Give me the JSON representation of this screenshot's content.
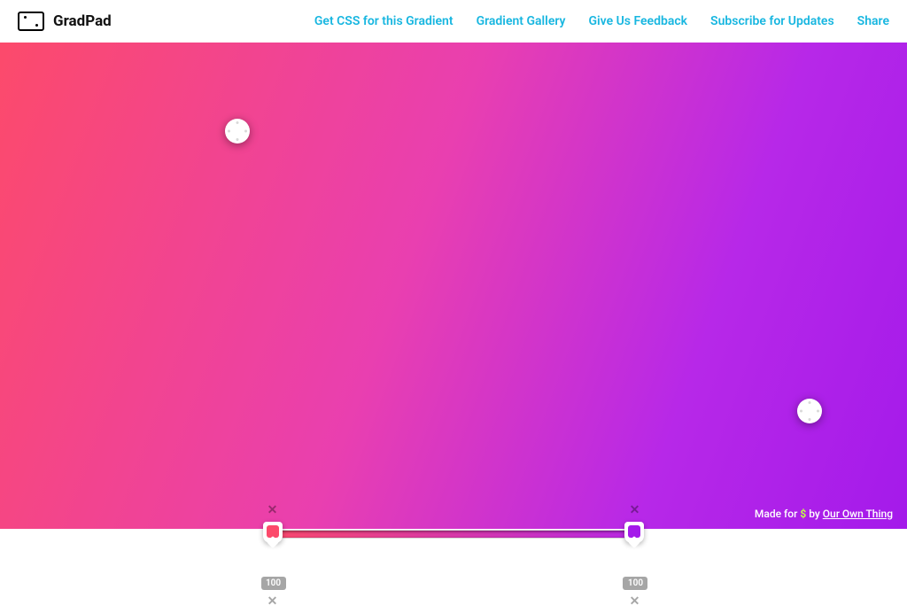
{
  "header": {
    "brand": "GradPad",
    "nav": {
      "getCss": "Get CSS for this Gradient",
      "gallery": "Gradient Gallery",
      "feedback": "Give Us Feedback",
      "subscribe": "Subscribe for Updates",
      "share": "Share"
    }
  },
  "gradient": {
    "colors": {
      "stop1": "#fc4a6b",
      "stop2": "#a41aea"
    }
  },
  "stops": {
    "stop1": {
      "opacity": "100"
    },
    "stop2": {
      "opacity": "100"
    }
  },
  "footer": {
    "prefix": "Made for ",
    "dollar": "$",
    "by": " by ",
    "author": "Our Own Thing"
  }
}
